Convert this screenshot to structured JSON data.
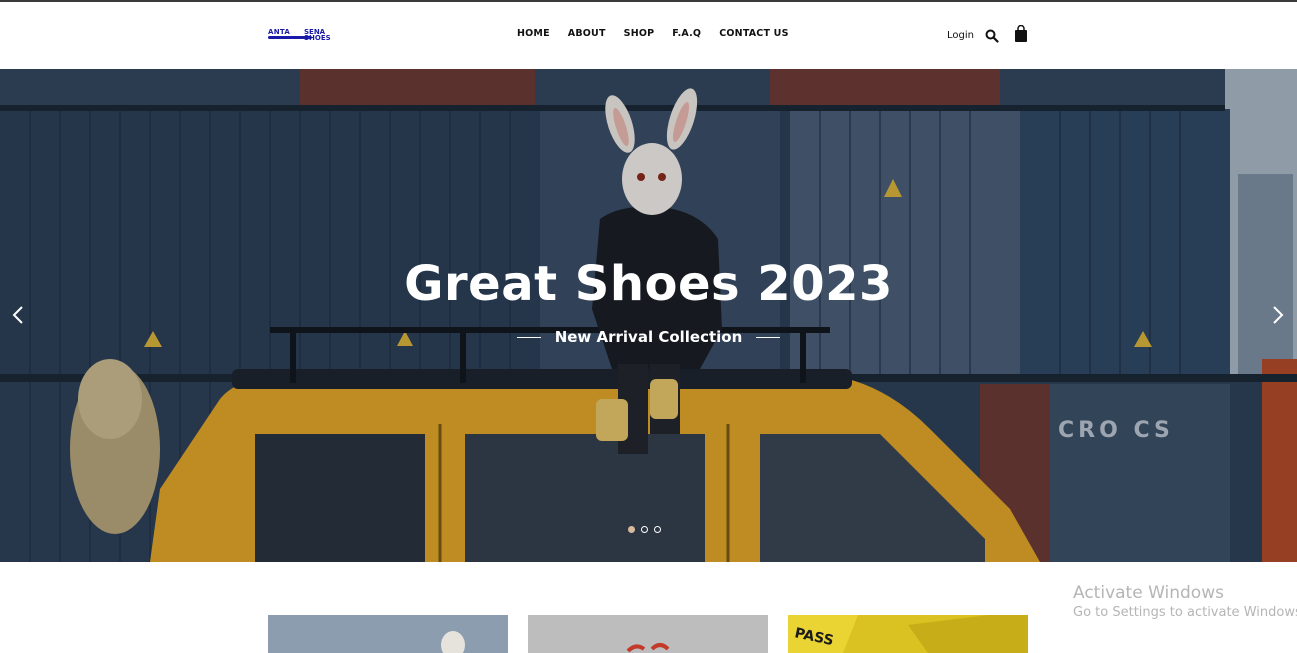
{
  "header": {
    "logo": {
      "line1": "ANTA",
      "line2": "SENA",
      "line3": "SHOES"
    },
    "nav": [
      {
        "label": "HOME"
      },
      {
        "label": "ABOUT"
      },
      {
        "label": "SHOP"
      },
      {
        "label": "F.A.Q"
      },
      {
        "label": "CONTACT US"
      }
    ],
    "login_label": "Login",
    "icons": [
      "search-icon",
      "shopping-bag-icon"
    ]
  },
  "hero": {
    "title": "Great Shoes 2023",
    "subtitle": "New Arrival Collection",
    "slide_count": 3,
    "active_slide": 1,
    "container_texts": [
      "CRO  CS"
    ]
  },
  "watermark": {
    "title": "Activate Windows",
    "subtitle": "Go to Settings to activate Windows."
  },
  "colors": {
    "logo": "#1a1aa8",
    "active_dot": "#d9b99b",
    "hero_text": "#ffffff"
  }
}
